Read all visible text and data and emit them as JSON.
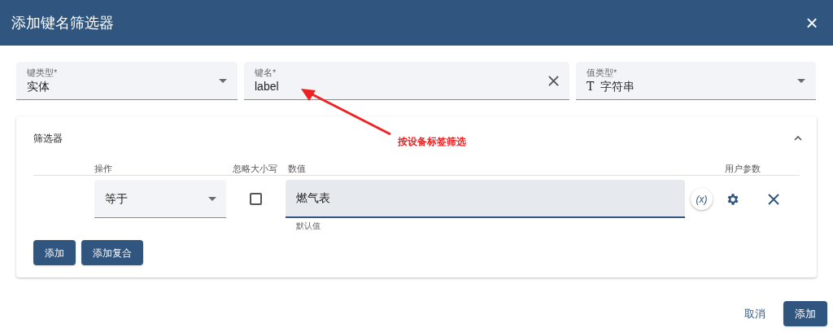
{
  "dialog": {
    "title": "添加键名筛选器",
    "close_icon": "×"
  },
  "fields": [
    {
      "kind": "select",
      "label": "键类型*",
      "value": "实体"
    },
    {
      "kind": "text",
      "label": "键名*",
      "value": "label"
    },
    {
      "kind": "select",
      "label": "值类型*",
      "value": "字符串",
      "type_icon": "T"
    }
  ],
  "annotation": {
    "text": "按设备标签筛选"
  },
  "filters": {
    "title": "筛选器",
    "expanded": true,
    "columns": [
      "操作",
      "忽略大小写",
      "数值",
      "用户参数"
    ],
    "rows": [
      {
        "operation": "等于",
        "ignore_case": false,
        "value": "燃气表",
        "hint": "默认值",
        "param_icon": "(x)"
      }
    ],
    "buttons": [
      "添加",
      "添加复合"
    ]
  },
  "footer": {
    "cancel": "取消",
    "submit": "添加"
  }
}
